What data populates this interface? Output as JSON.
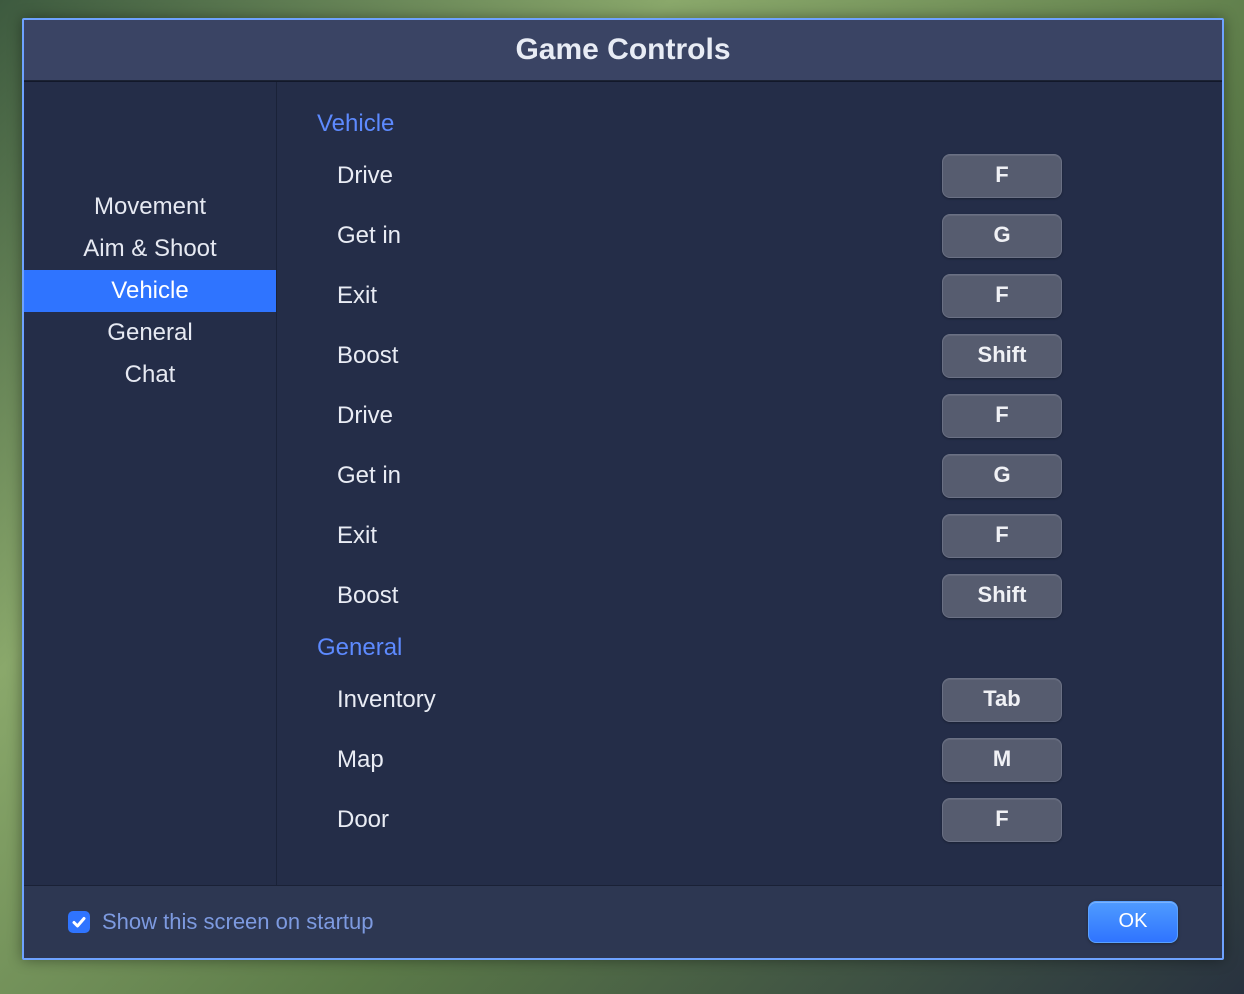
{
  "title": "Game Controls",
  "sidebar": {
    "items": [
      {
        "label": "Movement",
        "selected": false
      },
      {
        "label": "Aim & Shoot",
        "selected": false
      },
      {
        "label": "Vehicle",
        "selected": true
      },
      {
        "label": "General",
        "selected": false
      },
      {
        "label": "Chat",
        "selected": false
      }
    ]
  },
  "sections": [
    {
      "heading": "Vehicle",
      "rows": [
        {
          "label": "Drive",
          "key": "F"
        },
        {
          "label": "Get in",
          "key": "G"
        },
        {
          "label": "Exit",
          "key": "F"
        },
        {
          "label": "Boost",
          "key": "Shift"
        },
        {
          "label": "Drive",
          "key": "F"
        },
        {
          "label": "Get in",
          "key": "G"
        },
        {
          "label": "Exit",
          "key": "F"
        },
        {
          "label": "Boost",
          "key": "Shift"
        }
      ]
    },
    {
      "heading": "General",
      "rows": [
        {
          "label": "Inventory",
          "key": "Tab"
        },
        {
          "label": "Map",
          "key": "M"
        },
        {
          "label": "Door",
          "key": "F"
        }
      ]
    }
  ],
  "footer": {
    "show_on_startup_label": "Show this screen on startup",
    "show_on_startup_checked": true,
    "ok_label": "OK"
  }
}
